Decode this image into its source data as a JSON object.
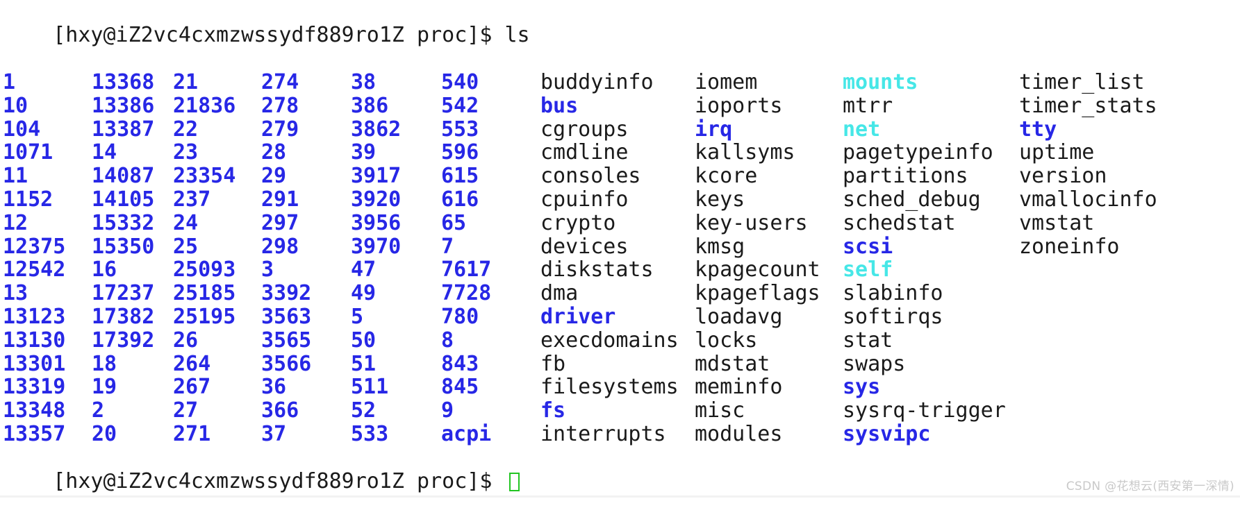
{
  "terminal": {
    "prompt_top": "[hxy@iZ2vc4cxmzwssydf889ro1Z proc]$ ls",
    "prompt_bottom": "[hxy@iZ2vc4cxmzwssydf889ro1Z proc]$ ",
    "user": "hxy",
    "host": "iZ2vc4cxmzwssydf889ro1Z",
    "cwd": "proc",
    "command": "ls",
    "cursor": "block-cursor",
    "colors": {
      "background": "#ffffff",
      "text": "#1a1a1a",
      "directory": "#2727e6",
      "symlink": "#46e7e7",
      "cursor": "#22c522"
    }
  },
  "watermark": {
    "text": "CSDN @花想云(西安第一深情)"
  },
  "ls_output": {
    "columns": 10,
    "rows": 17,
    "grid": [
      [
        {
          "name": "1",
          "type": "dir"
        },
        {
          "name": "13368",
          "type": "dir"
        },
        {
          "name": "21",
          "type": "dir"
        },
        {
          "name": "274",
          "type": "dir"
        },
        {
          "name": "38",
          "type": "dir"
        },
        {
          "name": "540",
          "type": "dir"
        },
        {
          "name": "buddyinfo",
          "type": "file"
        },
        {
          "name": "iomem",
          "type": "file"
        },
        {
          "name": "mounts",
          "type": "link"
        },
        {
          "name": "timer_list",
          "type": "file"
        }
      ],
      [
        {
          "name": "10",
          "type": "dir"
        },
        {
          "name": "13386",
          "type": "dir"
        },
        {
          "name": "21836",
          "type": "dir"
        },
        {
          "name": "278",
          "type": "dir"
        },
        {
          "name": "386",
          "type": "dir"
        },
        {
          "name": "542",
          "type": "dir"
        },
        {
          "name": "bus",
          "type": "dir"
        },
        {
          "name": "ioports",
          "type": "file"
        },
        {
          "name": "mtrr",
          "type": "file"
        },
        {
          "name": "timer_stats",
          "type": "file"
        }
      ],
      [
        {
          "name": "104",
          "type": "dir"
        },
        {
          "name": "13387",
          "type": "dir"
        },
        {
          "name": "22",
          "type": "dir"
        },
        {
          "name": "279",
          "type": "dir"
        },
        {
          "name": "3862",
          "type": "dir"
        },
        {
          "name": "553",
          "type": "dir"
        },
        {
          "name": "cgroups",
          "type": "file"
        },
        {
          "name": "irq",
          "type": "dir"
        },
        {
          "name": "net",
          "type": "link"
        },
        {
          "name": "tty",
          "type": "dir"
        }
      ],
      [
        {
          "name": "1071",
          "type": "dir"
        },
        {
          "name": "14",
          "type": "dir"
        },
        {
          "name": "23",
          "type": "dir"
        },
        {
          "name": "28",
          "type": "dir"
        },
        {
          "name": "39",
          "type": "dir"
        },
        {
          "name": "596",
          "type": "dir"
        },
        {
          "name": "cmdline",
          "type": "file"
        },
        {
          "name": "kallsyms",
          "type": "file"
        },
        {
          "name": "pagetypeinfo",
          "type": "file"
        },
        {
          "name": "uptime",
          "type": "file"
        }
      ],
      [
        {
          "name": "11",
          "type": "dir"
        },
        {
          "name": "14087",
          "type": "dir"
        },
        {
          "name": "23354",
          "type": "dir"
        },
        {
          "name": "29",
          "type": "dir"
        },
        {
          "name": "3917",
          "type": "dir"
        },
        {
          "name": "615",
          "type": "dir"
        },
        {
          "name": "consoles",
          "type": "file"
        },
        {
          "name": "kcore",
          "type": "file"
        },
        {
          "name": "partitions",
          "type": "file"
        },
        {
          "name": "version",
          "type": "file"
        }
      ],
      [
        {
          "name": "1152",
          "type": "dir"
        },
        {
          "name": "14105",
          "type": "dir"
        },
        {
          "name": "237",
          "type": "dir"
        },
        {
          "name": "291",
          "type": "dir"
        },
        {
          "name": "3920",
          "type": "dir"
        },
        {
          "name": "616",
          "type": "dir"
        },
        {
          "name": "cpuinfo",
          "type": "file"
        },
        {
          "name": "keys",
          "type": "file"
        },
        {
          "name": "sched_debug",
          "type": "file"
        },
        {
          "name": "vmallocinfo",
          "type": "file"
        }
      ],
      [
        {
          "name": "12",
          "type": "dir"
        },
        {
          "name": "15332",
          "type": "dir"
        },
        {
          "name": "24",
          "type": "dir"
        },
        {
          "name": "297",
          "type": "dir"
        },
        {
          "name": "3956",
          "type": "dir"
        },
        {
          "name": "65",
          "type": "dir"
        },
        {
          "name": "crypto",
          "type": "file"
        },
        {
          "name": "key-users",
          "type": "file"
        },
        {
          "name": "schedstat",
          "type": "file"
        },
        {
          "name": "vmstat",
          "type": "file"
        }
      ],
      [
        {
          "name": "12375",
          "type": "dir"
        },
        {
          "name": "15350",
          "type": "dir"
        },
        {
          "name": "25",
          "type": "dir"
        },
        {
          "name": "298",
          "type": "dir"
        },
        {
          "name": "3970",
          "type": "dir"
        },
        {
          "name": "7",
          "type": "dir"
        },
        {
          "name": "devices",
          "type": "file"
        },
        {
          "name": "kmsg",
          "type": "file"
        },
        {
          "name": "scsi",
          "type": "dir"
        },
        {
          "name": "zoneinfo",
          "type": "file"
        }
      ],
      [
        {
          "name": "12542",
          "type": "dir"
        },
        {
          "name": "16",
          "type": "dir"
        },
        {
          "name": "25093",
          "type": "dir"
        },
        {
          "name": "3",
          "type": "dir"
        },
        {
          "name": "47",
          "type": "dir"
        },
        {
          "name": "7617",
          "type": "dir"
        },
        {
          "name": "diskstats",
          "type": "file"
        },
        {
          "name": "kpagecount",
          "type": "file"
        },
        {
          "name": "self",
          "type": "link"
        },
        {
          "name": "",
          "type": "file"
        }
      ],
      [
        {
          "name": "13",
          "type": "dir"
        },
        {
          "name": "17237",
          "type": "dir"
        },
        {
          "name": "25185",
          "type": "dir"
        },
        {
          "name": "3392",
          "type": "dir"
        },
        {
          "name": "49",
          "type": "dir"
        },
        {
          "name": "7728",
          "type": "dir"
        },
        {
          "name": "dma",
          "type": "file"
        },
        {
          "name": "kpageflags",
          "type": "file"
        },
        {
          "name": "slabinfo",
          "type": "file"
        },
        {
          "name": "",
          "type": "file"
        }
      ],
      [
        {
          "name": "13123",
          "type": "dir"
        },
        {
          "name": "17382",
          "type": "dir"
        },
        {
          "name": "25195",
          "type": "dir"
        },
        {
          "name": "3563",
          "type": "dir"
        },
        {
          "name": "5",
          "type": "dir"
        },
        {
          "name": "780",
          "type": "dir"
        },
        {
          "name": "driver",
          "type": "dir"
        },
        {
          "name": "loadavg",
          "type": "file"
        },
        {
          "name": "softirqs",
          "type": "file"
        },
        {
          "name": "",
          "type": "file"
        }
      ],
      [
        {
          "name": "13130",
          "type": "dir"
        },
        {
          "name": "17392",
          "type": "dir"
        },
        {
          "name": "26",
          "type": "dir"
        },
        {
          "name": "3565",
          "type": "dir"
        },
        {
          "name": "50",
          "type": "dir"
        },
        {
          "name": "8",
          "type": "dir"
        },
        {
          "name": "execdomains",
          "type": "file"
        },
        {
          "name": "locks",
          "type": "file"
        },
        {
          "name": "stat",
          "type": "file"
        },
        {
          "name": "",
          "type": "file"
        }
      ],
      [
        {
          "name": "13301",
          "type": "dir"
        },
        {
          "name": "18",
          "type": "dir"
        },
        {
          "name": "264",
          "type": "dir"
        },
        {
          "name": "3566",
          "type": "dir"
        },
        {
          "name": "51",
          "type": "dir"
        },
        {
          "name": "843",
          "type": "dir"
        },
        {
          "name": "fb",
          "type": "file"
        },
        {
          "name": "mdstat",
          "type": "file"
        },
        {
          "name": "swaps",
          "type": "file"
        },
        {
          "name": "",
          "type": "file"
        }
      ],
      [
        {
          "name": "13319",
          "type": "dir"
        },
        {
          "name": "19",
          "type": "dir"
        },
        {
          "name": "267",
          "type": "dir"
        },
        {
          "name": "36",
          "type": "dir"
        },
        {
          "name": "511",
          "type": "dir"
        },
        {
          "name": "845",
          "type": "dir"
        },
        {
          "name": "filesystems",
          "type": "file"
        },
        {
          "name": "meminfo",
          "type": "file"
        },
        {
          "name": "sys",
          "type": "dir"
        },
        {
          "name": "",
          "type": "file"
        }
      ],
      [
        {
          "name": "13348",
          "type": "dir"
        },
        {
          "name": "2",
          "type": "dir"
        },
        {
          "name": "27",
          "type": "dir"
        },
        {
          "name": "366",
          "type": "dir"
        },
        {
          "name": "52",
          "type": "dir"
        },
        {
          "name": "9",
          "type": "dir"
        },
        {
          "name": "fs",
          "type": "dir"
        },
        {
          "name": "misc",
          "type": "file"
        },
        {
          "name": "sysrq-trigger",
          "type": "file"
        },
        {
          "name": "",
          "type": "file"
        }
      ],
      [
        {
          "name": "13357",
          "type": "dir"
        },
        {
          "name": "20",
          "type": "dir"
        },
        {
          "name": "271",
          "type": "dir"
        },
        {
          "name": "37",
          "type": "dir"
        },
        {
          "name": "533",
          "type": "dir"
        },
        {
          "name": "acpi",
          "type": "dir"
        },
        {
          "name": "interrupts",
          "type": "file"
        },
        {
          "name": "modules",
          "type": "file"
        },
        {
          "name": "sysvipc",
          "type": "dir"
        },
        {
          "name": "",
          "type": "file"
        }
      ]
    ]
  }
}
